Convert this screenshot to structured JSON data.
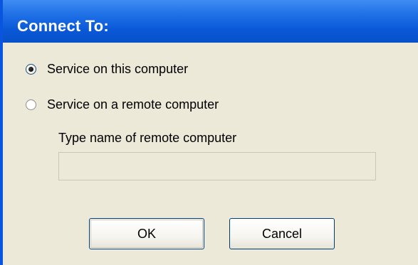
{
  "dialog": {
    "title": "Connect To:"
  },
  "options": [
    {
      "label": "Service on this computer",
      "selected": true
    },
    {
      "label": "Service on a remote computer",
      "selected": false
    }
  ],
  "remote": {
    "field_label": "Type name of remote computer",
    "value": "",
    "placeholder": ""
  },
  "buttons": {
    "ok_label": "OK",
    "cancel_label": "Cancel"
  },
  "colors": {
    "titlebar": "#0a58d8",
    "dialog_background": "#ece9d8",
    "title_text": "#ffffff"
  }
}
